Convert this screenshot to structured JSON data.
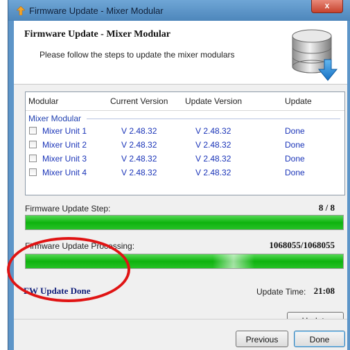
{
  "window": {
    "title": "Firmware Update - Mixer Modular",
    "close_glyph": "x"
  },
  "header": {
    "title": "Firmware Update - Mixer Modular",
    "subtitle": "Please follow the steps to update the mixer modulars",
    "icon": "database-download-icon"
  },
  "table": {
    "columns": [
      "Modular",
      "Current Version",
      "Update Version",
      "Update"
    ],
    "group_label": "Mixer Modular",
    "rows": [
      {
        "name": "Mixer Unit 1",
        "current": "V 2.48.32",
        "update": "V 2.48.32",
        "status": "Done",
        "checked": false
      },
      {
        "name": "Mixer Unit 2",
        "current": "V 2.48.32",
        "update": "V 2.48.32",
        "status": "Done",
        "checked": false
      },
      {
        "name": "Mixer Unit 3",
        "current": "V 2.48.32",
        "update": "V 2.48.32",
        "status": "Done",
        "checked": false
      },
      {
        "name": "Mixer Unit 4",
        "current": "V 2.48.32",
        "update": "V 2.48.32",
        "status": "Done",
        "checked": false
      }
    ]
  },
  "progress": {
    "step_label": "Firmware Update Step:",
    "step_value": "8 / 8",
    "step_fraction": 1.0,
    "processing_label": "Firmware Update Processing:",
    "processing_value": "1068055/1068055",
    "processing_fraction": 1.0
  },
  "status": {
    "message": "FW Update Done",
    "time_label": "Update Time:",
    "time_value": "21:08"
  },
  "buttons": {
    "update": "Update",
    "previous": "Previous",
    "done": "Done"
  },
  "colors": {
    "progress_fill": "#1bbb1b",
    "annotation_circle": "#e01414",
    "version_text": "#1a34b8",
    "status_text": "#101e7a"
  }
}
